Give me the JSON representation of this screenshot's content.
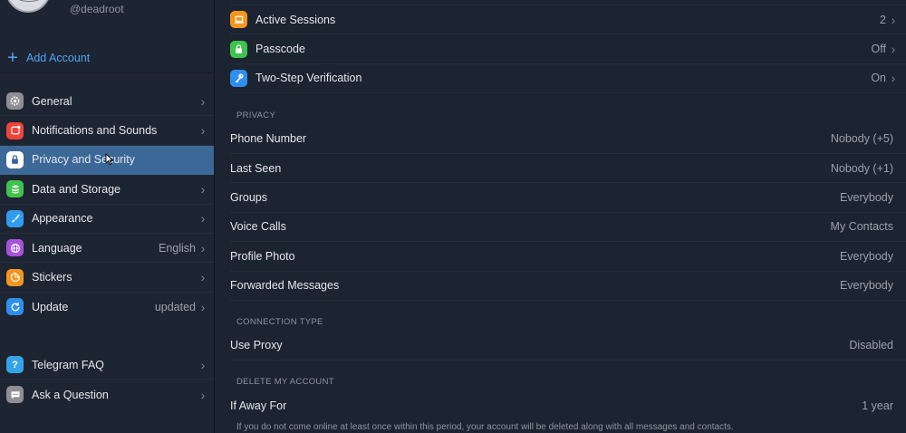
{
  "account": {
    "username": "@deadroot",
    "add_account": "Add Account"
  },
  "sidebar": {
    "items": [
      {
        "label": "General",
        "icon": "gear-icon",
        "color": "#8e8e93",
        "value": ""
      },
      {
        "label": "Notifications and Sounds",
        "icon": "bell-icon",
        "color": "#f04438",
        "value": ""
      },
      {
        "label": "Privacy and Security",
        "icon": "lock-icon",
        "color": "#ffffff",
        "value": ""
      },
      {
        "label": "Data and Storage",
        "icon": "database-icon",
        "color": "#3ec34c",
        "value": ""
      },
      {
        "label": "Appearance",
        "icon": "brush-icon",
        "color": "#2f9cf0",
        "value": ""
      },
      {
        "label": "Language",
        "icon": "globe-icon",
        "color": "#a552dc",
        "value": "English"
      },
      {
        "label": "Stickers",
        "icon": "sticker-icon",
        "color": "#f5951f",
        "value": ""
      },
      {
        "label": "Update",
        "icon": "refresh-icon",
        "color": "#2f8ff0",
        "value": "updated"
      }
    ],
    "help": [
      {
        "label": "Telegram FAQ",
        "icon": "question-icon",
        "color": "#35a3e8"
      },
      {
        "label": "Ask a Question",
        "icon": "chat-icon",
        "color": "#8e8e93"
      }
    ]
  },
  "security": {
    "active_sessions": {
      "label": "Active Sessions",
      "value": "2",
      "color": "#f5951f"
    },
    "passcode": {
      "label": "Passcode",
      "value": "Off",
      "color": "#3ec34c"
    },
    "two_step": {
      "label": "Two-Step Verification",
      "value": "On",
      "color": "#2f8ff0"
    }
  },
  "privacy": {
    "header": "PRIVACY",
    "rows": [
      {
        "label": "Phone Number",
        "value": "Nobody (+5)"
      },
      {
        "label": "Last Seen",
        "value": "Nobody (+1)"
      },
      {
        "label": "Groups",
        "value": "Everybody"
      },
      {
        "label": "Voice Calls",
        "value": "My Contacts"
      },
      {
        "label": "Profile Photo",
        "value": "Everybody"
      },
      {
        "label": "Forwarded Messages",
        "value": "Everybody"
      }
    ]
  },
  "connection": {
    "header": "CONNECTION TYPE",
    "label": "Use Proxy",
    "value": "Disabled"
  },
  "delete_account": {
    "header": "DELETE MY ACCOUNT",
    "label": "If Away For",
    "value": "1 year",
    "note": "If you do not come online at least once within this period, your account will be deleted along with all messages and contacts."
  }
}
